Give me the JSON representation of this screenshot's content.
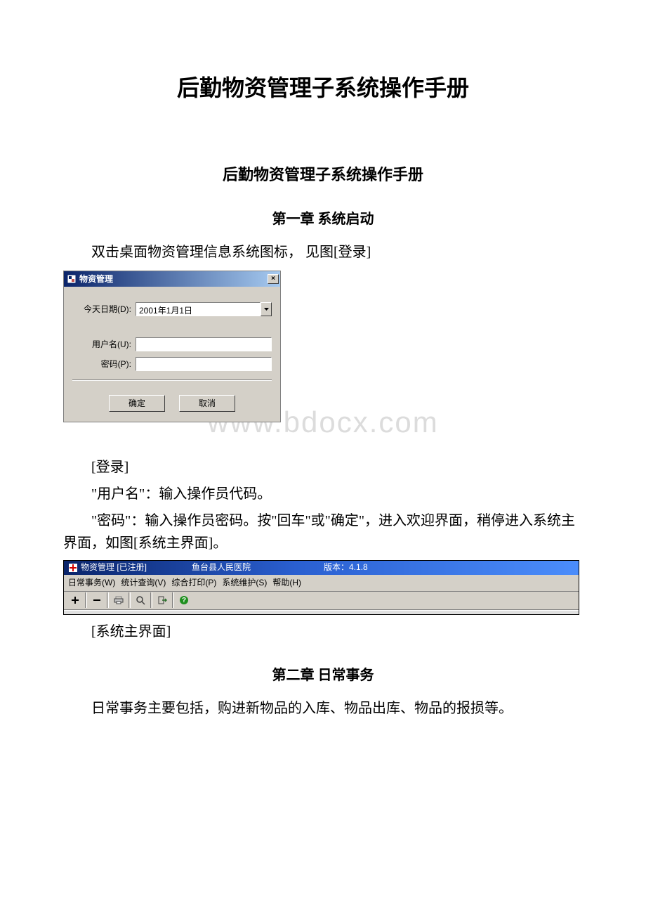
{
  "heading_main": "后勤物资管理子系统操作手册",
  "heading_sub": "后勤物资管理子系统操作手册",
  "chapter1": {
    "title": "第一章 系统启动",
    "intro": "双击桌面物资管理信息系统图标， 见图[登录]"
  },
  "login_dialog": {
    "title": "物资管理",
    "close_glyph": "×",
    "date_label": "今天日期(D):",
    "date_value": "2001年1月1日",
    "user_label": "用户名(U):",
    "user_value": "",
    "pass_label": "密码(P):",
    "pass_value": "",
    "ok_label": "确定",
    "cancel_label": "取消"
  },
  "watermark_text": "www.bdocx.com",
  "login_caption": "[登录]",
  "login_explain_user": "\"用户名\"：输入操作员代码。",
  "login_explain_pass": "\"密码\"：输入操作员密码。按\"回车\"或\"确定\"，进入欢迎界面，稍停进入系统主界面，如图[系统主界面]。",
  "app_window": {
    "title_app": "物资管理  [已注册]",
    "title_org": "鱼台县人民医院",
    "title_ver": "版本：4.1.8",
    "menu": {
      "daily": "日常事务(W)",
      "stats": "统计查询(V)",
      "print": "综合打印(P)",
      "maint": "系统维护(S)",
      "help": "帮助(H)"
    }
  },
  "main_caption": "[系统主界面]",
  "chapter2": {
    "title": "第二章 日常事务",
    "intro": "日常事务主要包括，购进新物品的入库、物品出库、物品的报损等。"
  }
}
